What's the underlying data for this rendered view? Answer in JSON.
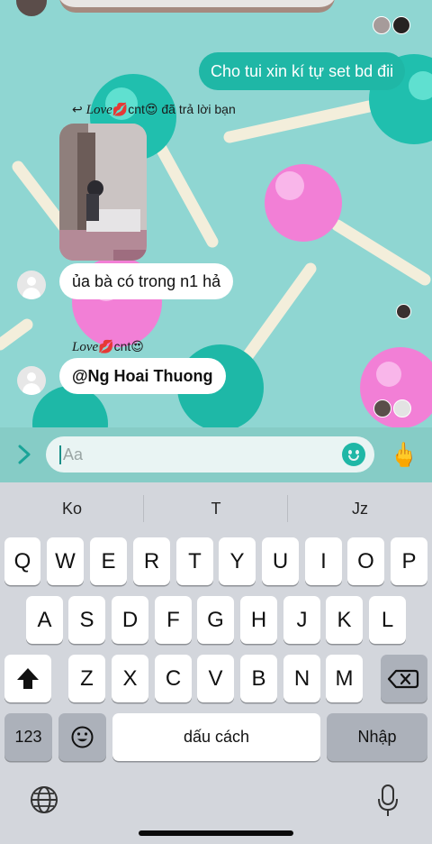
{
  "chat": {
    "outgoing_message": "Cho tui xin kí tự set bd đii",
    "reply_meta": {
      "arrow": "↩",
      "name_fancy": "Love",
      "name_suffix": "💋cnt😍",
      "action": "đã trả lời bạn"
    },
    "incoming_message_1": "ủa bà có trong n1 hả",
    "sender": {
      "name_fancy": "Love",
      "name_suffix": "💋cnt😍"
    },
    "incoming_message_2": "@Ng Hoai Thuong"
  },
  "composer": {
    "placeholder": "Aa",
    "hand_glyph": "🖕"
  },
  "keyboard": {
    "suggestions": [
      "Ko",
      "T",
      "Jz"
    ],
    "row1": [
      "Q",
      "W",
      "E",
      "R",
      "T",
      "Y",
      "U",
      "I",
      "O",
      "P"
    ],
    "row2": [
      "A",
      "S",
      "D",
      "F",
      "G",
      "H",
      "J",
      "K",
      "L"
    ],
    "row3": [
      "Z",
      "X",
      "C",
      "V",
      "B",
      "N",
      "M"
    ],
    "numbers_label": "123",
    "space_label": "dấu cách",
    "return_label": "Nhập"
  },
  "colors": {
    "accent": "#1fb7a6",
    "chat_background": "#8fd6d2",
    "keyboard_background": "#d3d6dc"
  },
  "icons": [
    "chevron-right-icon",
    "smiley-icon",
    "shift-icon",
    "backspace-icon",
    "emoji-icon",
    "globe-icon",
    "mic-icon"
  ]
}
